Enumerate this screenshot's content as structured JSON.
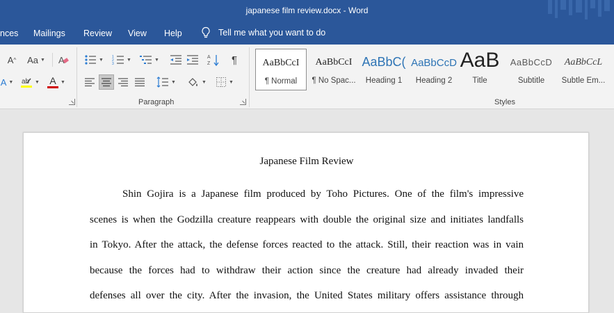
{
  "app": {
    "title": "japanese film review.docx  -  Word"
  },
  "tabs": [
    "nces",
    "Mailings",
    "Review",
    "View",
    "Help"
  ],
  "tell_me": "Tell me what you want to do",
  "ribbon": {
    "font_group": {
      "grow_label": "A",
      "case_label": "Aa",
      "font_color_label": "A",
      "colors": {
        "highlight": "#ffff00",
        "font_color": "#d00000"
      }
    },
    "paragraph_label": "Paragraph",
    "styles_label": "Styles",
    "styles": [
      {
        "preview": "AaBbCcI",
        "name": "¶ Normal"
      },
      {
        "preview": "AaBbCcI",
        "name": "¶ No Spac..."
      },
      {
        "preview": "AaBbC(",
        "name": "Heading 1"
      },
      {
        "preview": "AaBbCcD",
        "name": "Heading 2"
      },
      {
        "preview": "AaB",
        "name": "Title"
      },
      {
        "preview": "AaBbCcD",
        "name": "Subtitle"
      },
      {
        "preview": "AaBbCcL",
        "name": "Subtle Em..."
      }
    ]
  },
  "document": {
    "title": "Japanese Film Review",
    "lines": [
      "Shin Gojira is a Japanese film produced by Toho Pictures. One of the film's impressive",
      "scenes is when the Godzilla creature reappears with double the original size and initiates landfalls",
      "in Tokyo. After the attack, the defense forces reacted to the attack. Still, their reaction was in vain",
      "because the forces had to withdraw their action since the creature had already invaded their",
      "defenses all over the city. After the invasion, the United States military offers assistance through"
    ]
  },
  "colors": {
    "accent": "#2b579a",
    "ribbon_bg": "#f3f3f3",
    "page_bg": "#ffffff",
    "canvas_bg": "#e6e6e6"
  }
}
